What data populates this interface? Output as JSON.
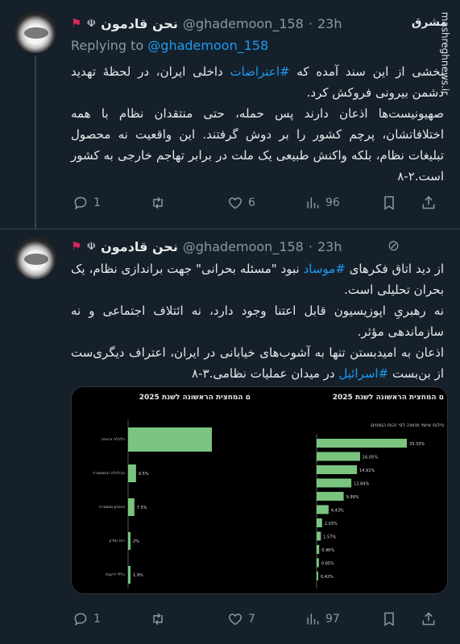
{
  "watermark": {
    "logo": "مشرق",
    "url": "mashreghnews.ir"
  },
  "tweet1": {
    "display_name": "نحن قادمون",
    "handle": "@ghademoon_158",
    "separator": "·",
    "time": "23h",
    "replying_label": "Replying to",
    "replying_mention": "@ghademoon_158",
    "body_lines": [
      "بخشی از این سند آمده که ",
      "#اعتراضات",
      " داخلی ایران، در لحظهٔ تهدید دشمن بیرونی فروکش کرد.",
      "صهیونیست‌ها اذعان دارند پس حمله، حتی منتقدان نظام با همه اختلافاتشان، پرچم کشور را بر دوش گرفتند. این واقعیت نه محصول تبلیغات نظام، بلکه واکنش طبیعی یک ملت در برابر تهاجم خارجی به کشور است.۲-۸"
    ],
    "actions": {
      "replies": "1",
      "retweets": "",
      "likes": "6",
      "views": "96"
    }
  },
  "tweet2": {
    "display_name": "نحن قادمون",
    "handle": "@ghademoon_158",
    "separator": "·",
    "time": "23h",
    "body_parts": [
      "از دید اتاق فکرهای ",
      "#موساد",
      " نبود \"مسئله بحرانی\" جهت براندازی نظام، یک بحران تحلیلی است.",
      "نه رهبریِ اپوزیسیون قابل اعتنا وجود دارد، نه ائتلاف اجتماعی و نه سازماندهی مؤثر.",
      "اذعان به امیدبستن تنها به آشوب‌های خیابانی در ایران، اعتراف دیگری‌ست از بن‌بست ",
      "#اسرائیل",
      " در میدان عملیات نظامی.۳-۸"
    ],
    "actions": {
      "replies": "1",
      "retweets": "",
      "likes": "7",
      "views": "97"
    }
  },
  "colors": {
    "bg": "#15202b",
    "text": "#e7e9ea",
    "muted": "#8b98a5",
    "link": "#1d9bf0",
    "bar": "#7bc47f"
  },
  "chart_data": [
    {
      "type": "bar",
      "title": "ם המחצית הראשונה לשנת 2025",
      "categories": [
        "כלכלה ורווחה",
        "הכלכלה והמשטרה",
        "ביטחון ומשטרה",
        "רוח ומדע",
        "כללי ידיעות"
      ],
      "values": [
        100,
        9.5,
        7.5,
        2,
        1.9
      ],
      "labels": [
        "",
        "9.5%",
        "7.5%",
        "2%",
        "1.9%"
      ]
    },
    {
      "type": "bar",
      "title": "ם המחצית הראשונה לשנת 2025",
      "subtitle": "פילוח איומי מחאה לפי זהות המוחים",
      "categories": [
        "",
        "",
        "",
        "",
        "",
        "",
        "",
        "",
        "",
        "",
        ""
      ],
      "values": [
        33.33,
        16.05,
        14.91,
        12.84,
        9.99,
        4.43,
        2.03,
        1.57,
        0.96,
        0.85,
        0.42
      ],
      "labels": [
        "33.33%",
        "16.05%",
        "14.91%",
        "12.84%",
        "9.99%",
        "4.43%",
        "2.03%",
        "1.57%",
        "0.96%",
        "0.85%",
        "0.42%"
      ]
    }
  ]
}
